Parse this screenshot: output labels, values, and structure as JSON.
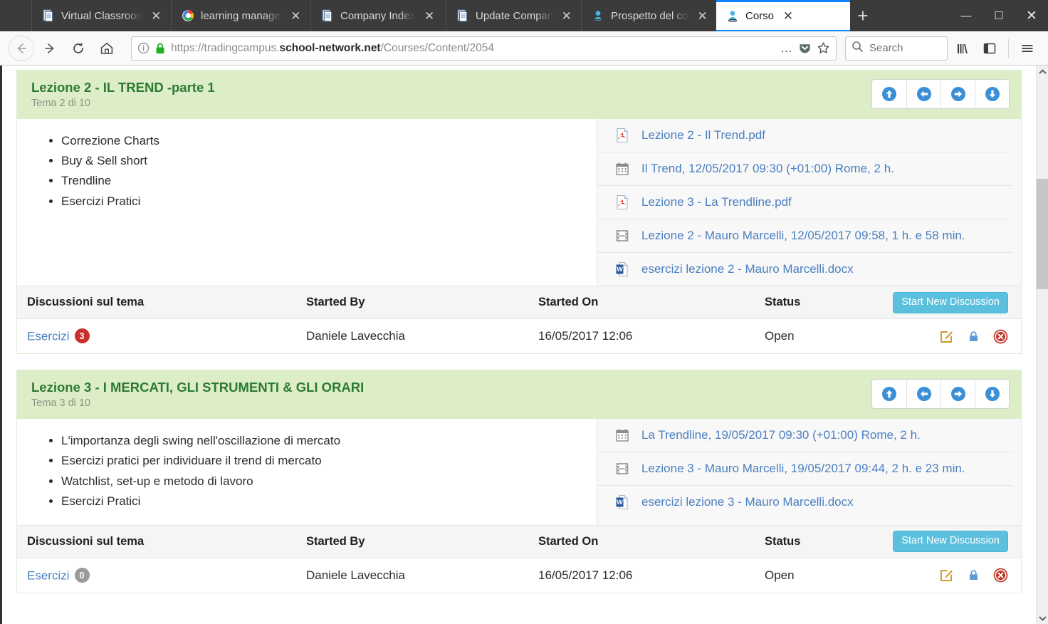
{
  "browser": {
    "tabs": [
      {
        "title": "Virtual Classroom",
        "favicon": "document-icon",
        "active": false,
        "close_label": "✕"
      },
      {
        "title": "learning manager",
        "favicon": "google-icon",
        "active": false,
        "close_label": "✕"
      },
      {
        "title": "Company Index",
        "favicon": "document-icon",
        "active": false,
        "close_label": "✕"
      },
      {
        "title": "Update Company",
        "favicon": "document-icon",
        "active": false,
        "close_label": "✕"
      },
      {
        "title": "Prospetto del corso",
        "favicon": "person-icon",
        "active": false,
        "close_label": "✕"
      },
      {
        "title": "Corso",
        "favicon": "person-icon",
        "active": true,
        "close_label": "✕"
      }
    ],
    "new_tab_label": "+",
    "window_controls": {
      "minimize": "—",
      "maximize": "☐",
      "close": "✕"
    },
    "url": {
      "prefix": "https://tradingcampus.",
      "domain": "school-network.net",
      "path": "/Courses/Content/2054",
      "info_icon": "info-icon",
      "lock_icon": "padlock-icon",
      "page_actions": "…",
      "pocket_icon": "pocket-icon",
      "bookmark_icon": "star-icon"
    },
    "search": {
      "placeholder": "Search",
      "icon": "search-icon"
    },
    "toolbar_icons": [
      "library-icon",
      "sidebar-icon",
      "hamburger-menu-icon"
    ],
    "nav_icons": {
      "back": "back-arrow-icon",
      "forward": "forward-arrow-icon",
      "reload": "reload-icon",
      "home": "home-icon"
    }
  },
  "colors": {
    "panel_header_bg": "#dcedc8",
    "panel_title": "#2e7a32",
    "link": "#4a7fc1",
    "info_button": "#5bc0de",
    "badge_red": "#c9302c",
    "badge_grey": "#9a9a9a",
    "arrow_blue": "#3a8fd6",
    "edit_icon": "#d19a2a",
    "lock_icon": "#5b9bd5",
    "delete_icon": "#c0392b",
    "pdf_icon": "#d9352c",
    "word_icon": "#2a5699",
    "grey_icon": "#8c8c8c"
  },
  "nav_buttons": [
    {
      "name": "move-up-button",
      "icon": "arrow-up-circle-icon"
    },
    {
      "name": "move-left-button",
      "icon": "arrow-left-circle-icon"
    },
    {
      "name": "move-right-button",
      "icon": "arrow-right-circle-icon"
    },
    {
      "name": "move-down-button",
      "icon": "arrow-down-circle-icon"
    }
  ],
  "discussion_table": {
    "columns": [
      "Discussioni sul tema",
      "Started By",
      "Started On",
      "Status"
    ],
    "new_discussion_label": "Start New Discussion",
    "row_icons": [
      {
        "name": "edit-discussion-icon",
        "glyph": "edit-square-icon"
      },
      {
        "name": "lock-discussion-icon",
        "glyph": "padlock-icon"
      },
      {
        "name": "delete-discussion-icon",
        "glyph": "delete-circle-icon"
      }
    ]
  },
  "lessons": [
    {
      "title": "Lezione 2 - IL TREND -parte 1",
      "subtitle": "Tema 2 di 10",
      "topics": [
        "Correzione Charts",
        "Buy & Sell short",
        "Trendline",
        "Esercizi Pratici"
      ],
      "resources": [
        {
          "icon": "pdf-icon",
          "label": "Lezione 2 - Il Trend.pdf"
        },
        {
          "icon": "calendar-icon",
          "label": "Il Trend, 12/05/2017 09:30 (+01:00) Rome, 2 h."
        },
        {
          "icon": "pdf-icon",
          "label": "Lezione 3 - La Trendline.pdf"
        },
        {
          "icon": "video-icon",
          "label": "Lezione 2 - Mauro Marcelli, 12/05/2017 09:58, 1 h. e 58 min."
        },
        {
          "icon": "word-icon",
          "label": "esercizi lezione 2 - Mauro Marcelli.docx"
        }
      ],
      "discussions": [
        {
          "title": "Esercizi",
          "replies": "3",
          "badge_style": "red",
          "started_by": "Daniele Lavecchia",
          "started_on": "16/05/2017 12:06",
          "status": "Open"
        }
      ]
    },
    {
      "title": "Lezione 3 - I MERCATI, GLI STRUMENTI & GLI ORARI",
      "subtitle": "Tema 3 di 10",
      "topics": [
        "L'importanza degli swing nell'oscillazione di mercato",
        "Esercizi pratici per individuare il trend di mercato",
        "Watchlist, set-up e metodo di lavoro",
        "Esercizi Pratici"
      ],
      "resources": [
        {
          "icon": "calendar-icon",
          "label": "La Trendline, 19/05/2017 09:30 (+01:00) Rome, 2 h."
        },
        {
          "icon": "video-icon",
          "label": "Lezione 3 - Mauro Marcelli, 19/05/2017 09:44, 2 h. e 23 min."
        },
        {
          "icon": "word-icon",
          "label": "esercizi lezione 3 - Mauro Marcelli.docx"
        }
      ],
      "discussions": [
        {
          "title": "Esercizi",
          "replies": "0",
          "badge_style": "grey",
          "started_by": "Daniele Lavecchia",
          "started_on": "16/05/2017 12:06",
          "status": "Open"
        }
      ]
    }
  ],
  "scrollbar": {
    "up_arrow": "▲",
    "down_arrow": "▼"
  }
}
